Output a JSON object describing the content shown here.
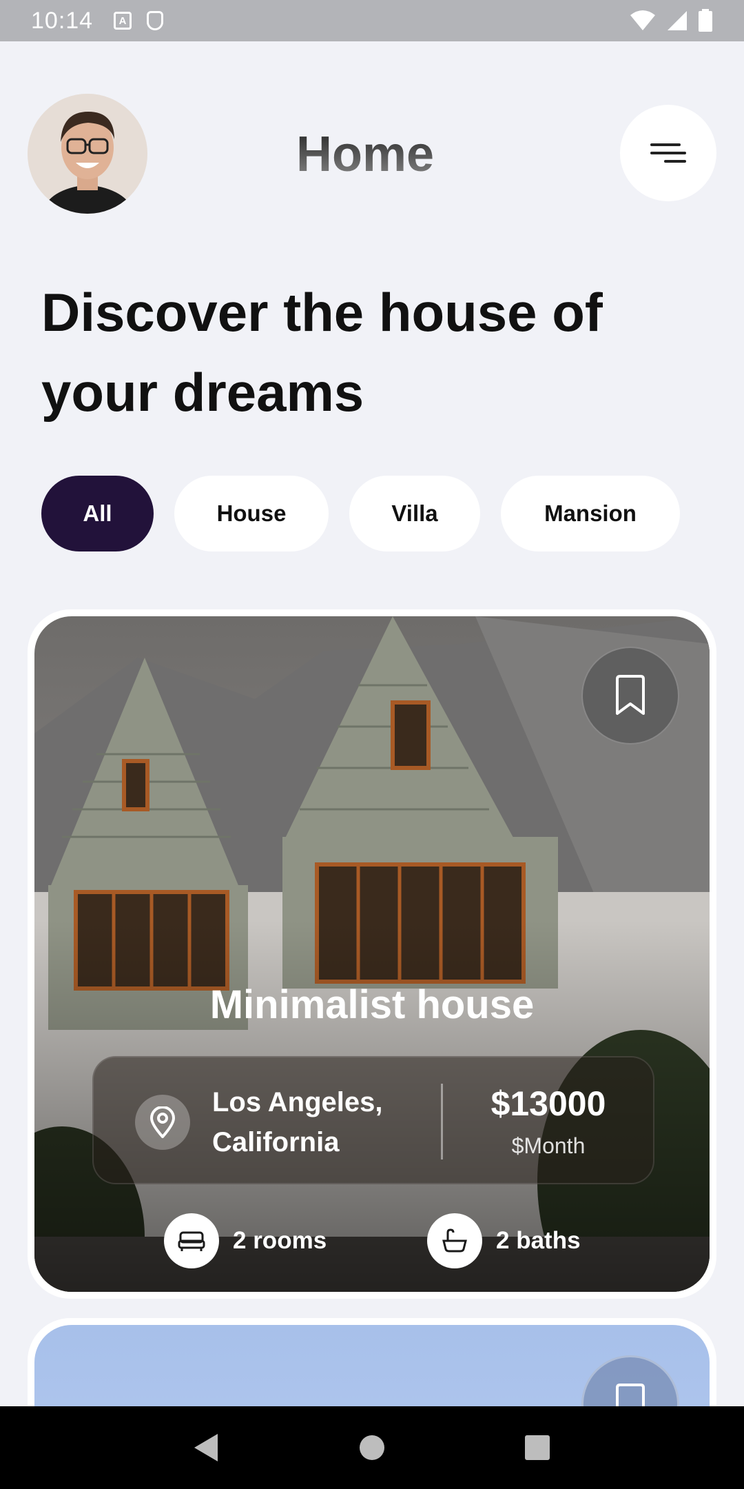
{
  "status_bar": {
    "time": "10:14",
    "left_icons": [
      "font-icon",
      "shield-icon"
    ],
    "right_icons": [
      "wifi-icon",
      "signal-icon",
      "battery-icon"
    ]
  },
  "header": {
    "logo_text": "Home",
    "avatar_icon": "avatar",
    "menu_icon": "menu-icon"
  },
  "hero": {
    "title": "Discover the house of your dreams"
  },
  "filters": {
    "chips": [
      {
        "label": "All",
        "active": true
      },
      {
        "label": "House",
        "active": false
      },
      {
        "label": "Villa",
        "active": false
      },
      {
        "label": "Mansion",
        "active": false
      }
    ]
  },
  "listings": [
    {
      "title": "Minimalist house",
      "location": "Los Angeles, California",
      "price": "$13000",
      "price_unit": "$Month",
      "rooms": "2 rooms",
      "baths": "2 baths",
      "bookmark_icon": "bookmark-icon",
      "location_icon": "location-pin-icon",
      "rooms_icon": "bed-icon",
      "baths_icon": "bathtub-icon"
    }
  ],
  "colors": {
    "background": "#f1f2f7",
    "accent": "#22123a",
    "card": "#ffffff"
  },
  "nav_bar": {
    "icons": [
      "back-icon",
      "home-icon",
      "recents-icon"
    ]
  }
}
